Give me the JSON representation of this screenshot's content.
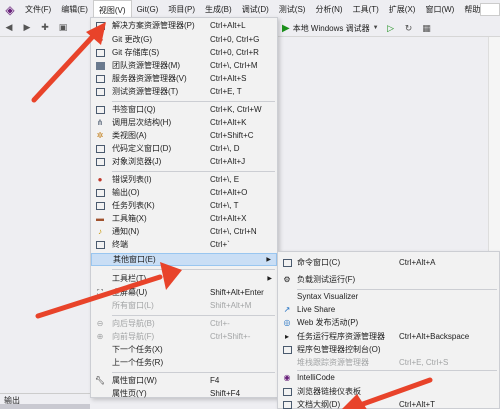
{
  "menubar": {
    "logo": "visual-studio-logo",
    "items": [
      "文件(F)",
      "编辑(E)",
      "视图(V)",
      "Git(G)",
      "项目(P)",
      "生成(B)",
      "调试(D)",
      "测试(S)",
      "分析(N)",
      "工具(T)",
      "扩展(X)",
      "窗口(W)",
      "帮助(H)"
    ],
    "active_index": 2
  },
  "toolbar": {
    "debugger_label": "本地 Windows 调试器"
  },
  "view_menu": {
    "items": [
      {
        "label": "解决方案资源管理器(P)",
        "shortcut": "Ctrl+Alt+L",
        "icon": "solution-explorer-icon"
      },
      {
        "label": "Git 更改(G)",
        "shortcut": "Ctrl+0, Ctrl+G",
        "icon": "git-changes-icon"
      },
      {
        "label": "Git 存储库(S)",
        "shortcut": "Ctrl+0, Ctrl+R",
        "icon": "git-repository-icon"
      },
      {
        "label": "团队资源管理器(M)",
        "shortcut": "Ctrl+\\, Ctrl+M",
        "icon": "team-explorer-icon"
      },
      {
        "label": "服务器资源管理器(V)",
        "shortcut": "Ctrl+Alt+S",
        "icon": "server-explorer-icon"
      },
      {
        "label": "测试资源管理器(T)",
        "shortcut": "Ctrl+E, T",
        "icon": "test-explorer-icon"
      },
      {
        "label": "书签窗口(Q)",
        "shortcut": "Ctrl+K, Ctrl+W",
        "icon": "bookmark-icon"
      },
      {
        "label": "调用层次结构(H)",
        "shortcut": "Ctrl+Alt+K",
        "icon": "call-hierarchy-icon"
      },
      {
        "label": "类视图(A)",
        "shortcut": "Ctrl+Shift+C",
        "icon": "class-view-icon"
      },
      {
        "label": "代码定义窗口(D)",
        "shortcut": "Ctrl+\\, D",
        "icon": "code-definition-icon"
      },
      {
        "label": "对象浏览器(J)",
        "shortcut": "Ctrl+Alt+J",
        "icon": "object-browser-icon"
      },
      {
        "label": "错误列表(I)",
        "shortcut": "Ctrl+\\, E",
        "icon": "error-list-icon"
      },
      {
        "label": "输出(O)",
        "shortcut": "Ctrl+Alt+O",
        "icon": "output-icon"
      },
      {
        "label": "任务列表(K)",
        "shortcut": "Ctrl+\\, T",
        "icon": "task-list-icon"
      },
      {
        "label": "工具箱(X)",
        "shortcut": "Ctrl+Alt+X",
        "icon": "toolbox-icon"
      },
      {
        "label": "通知(N)",
        "shortcut": "Ctrl+\\, Ctrl+N",
        "icon": "notification-bell-icon"
      },
      {
        "label": "终端",
        "shortcut": "Ctrl+`",
        "icon": "terminal-icon"
      },
      {
        "label": "其他窗口(E)",
        "shortcut": "",
        "icon": ""
      },
      {
        "label": "工具栏(T)",
        "shortcut": "",
        "icon": ""
      },
      {
        "label": "全屏幕(U)",
        "shortcut": "Shift+Alt+Enter",
        "icon": "fullscreen-icon"
      },
      {
        "label": "所有窗口(L)",
        "shortcut": "Shift+Alt+M",
        "icon": ""
      },
      {
        "label": "向后导航(B)",
        "shortcut": "Ctrl+-",
        "icon": "navigate-back-icon"
      },
      {
        "label": "向前导航(F)",
        "shortcut": "Ctrl+Shift+-",
        "icon": "navigate-forward-icon"
      },
      {
        "label": "下一个任务(X)",
        "shortcut": "",
        "icon": ""
      },
      {
        "label": "上一个任务(R)",
        "shortcut": "",
        "icon": ""
      },
      {
        "label": "属性窗口(W)",
        "shortcut": "F4",
        "icon": "wrench-icon"
      },
      {
        "label": "属性页(Y)",
        "shortcut": "Shift+F4",
        "icon": ""
      }
    ]
  },
  "other_windows_submenu": {
    "items": [
      {
        "label": "命令窗口(C)",
        "shortcut": "Ctrl+Alt+A",
        "icon": "command-window-icon"
      },
      {
        "label": "负载测试运行(F)",
        "shortcut": "",
        "icon": "load-test-icon"
      },
      {
        "label": "Syntax Visualizer",
        "shortcut": "",
        "icon": ""
      },
      {
        "label": "Live Share",
        "shortcut": "",
        "icon": "live-share-icon"
      },
      {
        "label": "Web 发布活动(P)",
        "shortcut": "",
        "icon": "web-publish-icon"
      },
      {
        "label": "任务运行程序资源管理器",
        "shortcut": "Ctrl+Alt+Backspace",
        "icon": "task-runner-icon"
      },
      {
        "label": "程序包管理器控制台(O)",
        "shortcut": "",
        "icon": "package-manager-icon"
      },
      {
        "label": "堆栈跟踪资源管理器",
        "shortcut": "Ctrl+E, Ctrl+S",
        "icon": ""
      },
      {
        "label": "IntelliCode",
        "shortcut": "",
        "icon": "intellicode-icon"
      },
      {
        "label": "浏览器链接仪表板",
        "shortcut": "",
        "icon": "browser-link-icon"
      },
      {
        "label": "文档大纲(D)",
        "shortcut": "Ctrl+Alt+T",
        "icon": "document-outline-icon"
      }
    ]
  },
  "output_bar": {
    "label": "输出"
  },
  "colors": {
    "highlight": "#c9def5",
    "annotation_arrow": "#e8432a",
    "vs_purple": "#68217a"
  }
}
